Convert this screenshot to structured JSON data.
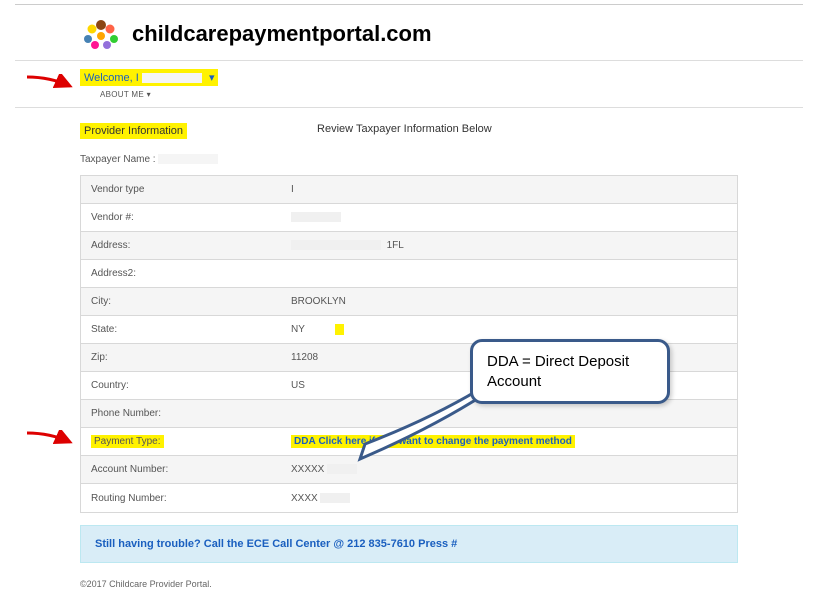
{
  "header": {
    "title": "childcarepaymentportal.com"
  },
  "welcome": {
    "label": "Welcome, I",
    "about_me": "ABOUT ME"
  },
  "section": {
    "title": "Provider Information",
    "subtitle": "Review Taxpayer Information Below",
    "taxpayer_label": "Taxpayer Name :"
  },
  "rows": {
    "vendor_type": {
      "label": "Vendor type",
      "value": "I"
    },
    "vendor_num": {
      "label": "Vendor #:",
      "value": ""
    },
    "address": {
      "label": "Address:",
      "value": "1FL"
    },
    "address2": {
      "label": "Address2:",
      "value": ""
    },
    "city": {
      "label": "City:",
      "value": "BROOKLYN"
    },
    "state": {
      "label": "State:",
      "value": "NY"
    },
    "zip": {
      "label": "Zip:",
      "value": "11208"
    },
    "country": {
      "label": "Country:",
      "value": "US"
    },
    "phone": {
      "label": "Phone Number:",
      "value": ""
    },
    "payment_type": {
      "label": "Payment Type:",
      "dda": "DDA",
      "link": "Click here if you want to change the payment method"
    },
    "account": {
      "label": "Account Number:",
      "value": "XXXXX"
    },
    "routing": {
      "label": "Routing Number:",
      "value": "XXXX"
    }
  },
  "help": {
    "text": "Still having trouble? Call the ECE Call Center @ 212 835-7610 Press #"
  },
  "footer": {
    "text": "©2017 Childcare Provider Portal."
  },
  "callout": {
    "text": "DDA = Direct Deposit Account"
  }
}
